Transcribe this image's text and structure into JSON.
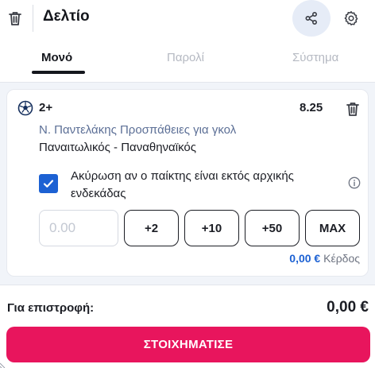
{
  "header": {
    "title": "Δελτίο",
    "tabs": [
      {
        "label": "Μονό",
        "active": true
      },
      {
        "label": "Παρολί",
        "active": false
      },
      {
        "label": "Σύστημα",
        "active": false
      }
    ],
    "icons": [
      "trash-icon",
      "share-icon",
      "gear-icon"
    ]
  },
  "bet": {
    "selection": "2+",
    "odds": "8.25",
    "market": "Ν. Παντελάκης Προσπάθειες για γκολ",
    "event": "Παναιτωλικός - Παναθηναϊκός",
    "void_option": {
      "checked": true,
      "label": "Ακύρωση αν ο παίκτης είναι εκτός αρχικής ενδεκάδας"
    },
    "stake": {
      "value": "",
      "placeholder": "0.00"
    },
    "quick_stakes": [
      "+2",
      "+10",
      "+50",
      "MAX"
    ],
    "potential_return": {
      "value": "0,00 €",
      "label": "Κέρδος"
    }
  },
  "footer": {
    "to_return_label": "Για επιστροφή:",
    "to_return_value": "0,00 €",
    "place_bet_label": "ΣΤΟΙΧΗΜΑΤΙΣΕ"
  },
  "colors": {
    "accent_blue": "#1c61d3",
    "bet_button": "#e8155d",
    "share_bg": "#e6ecf7",
    "background": "#f1f4f9"
  }
}
